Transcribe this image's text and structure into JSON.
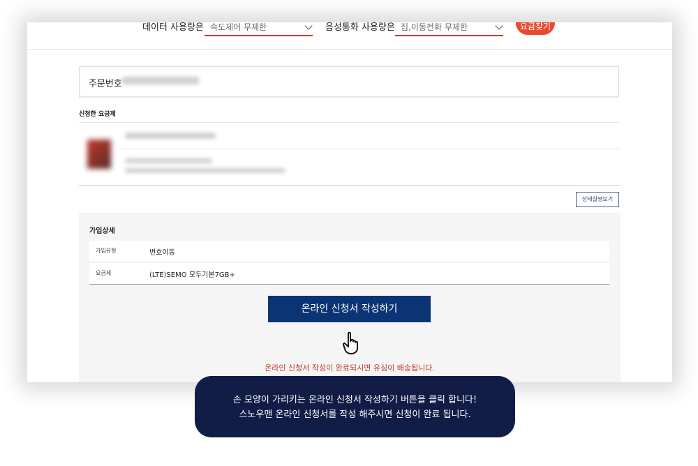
{
  "filters": {
    "data_label": "데이터 사용량은",
    "data_value": "속도제어 무제한",
    "voice_label": "음성통화 사용량은",
    "voice_value": "집,이동전화 무제한",
    "find_button": "요금찾기"
  },
  "order": {
    "label": "주문번호"
  },
  "plan_section": {
    "title": "신청한 요금제",
    "status_button": "상태설명보기"
  },
  "details": {
    "title": "가입상세",
    "rows": [
      {
        "key": "가입유형",
        "value": "번호이동"
      },
      {
        "key": "요금제",
        "value": "(LTE)SEMO 모두기본7GB+"
      }
    ]
  },
  "apply_button": "온라인 신청서 작성하기",
  "notice": "온라인 신청서 작성이 완료되시면 유심이 배송됩니다.",
  "tooltip": {
    "line1": "손 모양이 가리키는 온라인 신청서 작성하기 버튼을 클릭 합니다!",
    "line2": "스노우맨 온라인 신청서를 작성 해주시면 신청이 완료 됩니다."
  }
}
